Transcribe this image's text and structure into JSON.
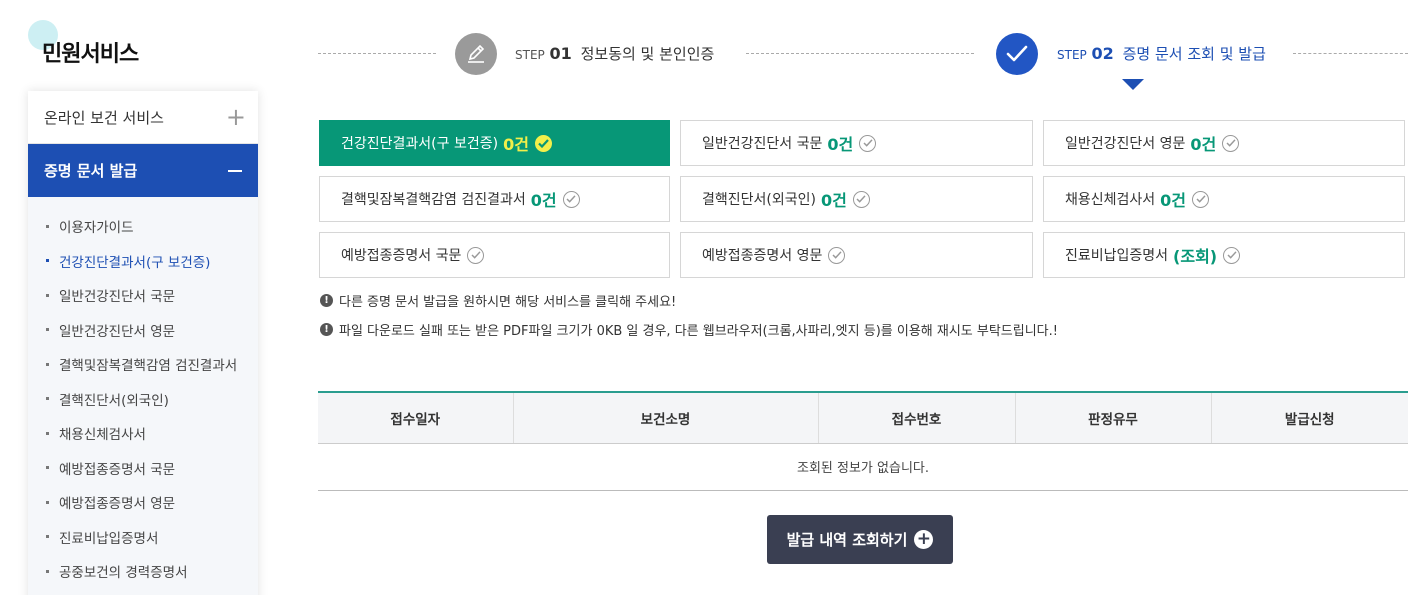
{
  "page": {
    "title": "민원서비스"
  },
  "sidebar": {
    "menu_online": {
      "label": "온라인 보건 서비스",
      "toggle": "+"
    },
    "menu_cert": {
      "label": "증명 문서 발급"
    },
    "subitems": [
      "이용자가이드",
      "건강진단결과서(구 보건증)",
      "일반건강진단서 국문",
      "일반건강진단서 영문",
      "결핵및잠복결핵감염 검진결과서",
      "결핵진단서(외국인)",
      "채용신체검사서",
      "예방접종증명서 국문",
      "예방접종증명서 영문",
      "진료비납입증명서",
      "공중보건의 경력증명서"
    ]
  },
  "steps": {
    "step1": {
      "word": "STEP",
      "num": "01",
      "label": "정보동의 및 본인인증"
    },
    "step2": {
      "word": "STEP",
      "num": "02",
      "label": "증명 문서 조회 및 발급"
    }
  },
  "docs": [
    {
      "label": "건강진단결과서(구 보건증)",
      "count": "0건"
    },
    {
      "label": "일반건강진단서 국문",
      "count": "0건"
    },
    {
      "label": "일반건강진단서 영문",
      "count": "0건"
    },
    {
      "label": "결핵및잠복결핵감염 검진결과서",
      "count": "0건"
    },
    {
      "label": "결핵진단서(외국인)",
      "count": "0건"
    },
    {
      "label": "채용신체검사서",
      "count": "0건"
    },
    {
      "label": "예방접종증명서 국문",
      "count": ""
    },
    {
      "label": "예방접종증명서 영문",
      "count": ""
    },
    {
      "label": "진료비납입증명서",
      "count": "(조회)"
    }
  ],
  "notices": [
    "다른 증명 문서 발급을 원하시면 해당 서비스를 클릭해 주세요!",
    "파일 다운로드 실패 또는 받은 PDF파일 크기가 0KB 일 경우, 다른 웹브라우저(크롬,사파리,엣지 등)를 이용해 재시도 부탁드립니다.!"
  ],
  "table": {
    "headers": [
      "접수일자",
      "보건소명",
      "접수번호",
      "판정유무",
      "발급신청"
    ],
    "empty_message": "조회된 정보가 없습니다."
  },
  "button": {
    "label": "발급 내역 조회하기"
  },
  "colors": {
    "active_green": "#079777",
    "primary_blue": "#1d4fb3",
    "count_yellow": "#f2ef4a",
    "button_dark": "#3a3f52"
  }
}
